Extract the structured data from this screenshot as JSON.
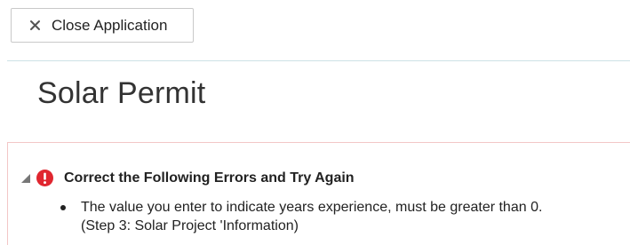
{
  "toolbar": {
    "close_label": "Close Application",
    "close_icon": "close-x-icon"
  },
  "page": {
    "title": "Solar Permit"
  },
  "errors": {
    "title": "Correct the Following Errors and Try Again",
    "caret_icon": "collapse-triangle-icon",
    "status_icon": "error-exclamation-icon",
    "error_color": "#e0262f",
    "items": [
      {
        "line1": "The value you enter to indicate years experience, must be greater than 0.",
        "line2": "(Step 3: Solar Project 'Information)"
      }
    ]
  }
}
